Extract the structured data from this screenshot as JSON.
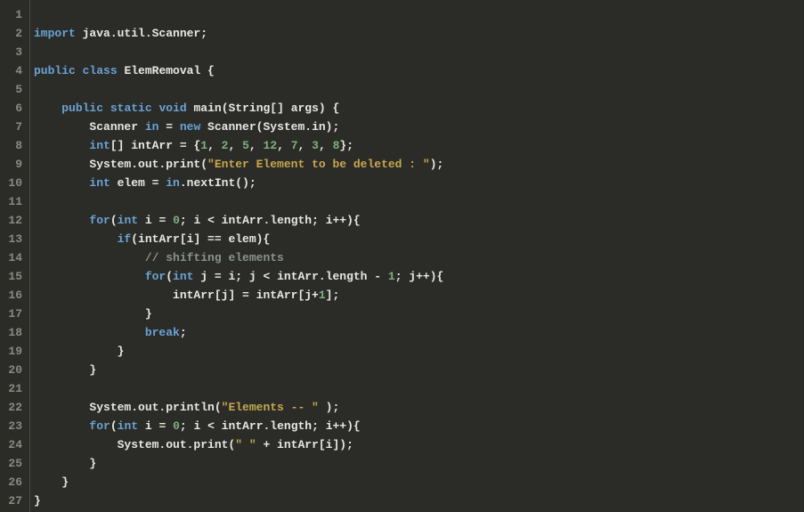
{
  "editor": {
    "lineNumbers": [
      1,
      2,
      3,
      4,
      5,
      6,
      7,
      8,
      9,
      10,
      11,
      12,
      13,
      14,
      15,
      16,
      17,
      18,
      19,
      20,
      21,
      22,
      23,
      24,
      25,
      26,
      27
    ],
    "lines": {
      "l1": "",
      "l2_import": "import",
      "l2_rest": " java.util.Scanner;",
      "l4_public": "public",
      "l4_class": "class",
      "l4_name": " ElemRemoval {",
      "l6_indent": "    ",
      "l6_public": "public",
      "l6_static": "static",
      "l6_void": "void",
      "l6_main": " main(String[] args) {",
      "l7_indent": "        Scanner ",
      "l7_in": "in",
      "l7_eq": " = ",
      "l7_new": "new",
      "l7_rest": " Scanner(System.in);",
      "l8_indent": "        ",
      "l8_int": "int",
      "l8_arr": "[] intArr = {",
      "l8_n1": "1",
      "l8_c": ", ",
      "l8_n2": "2",
      "l8_n3": "5",
      "l8_n4": "12",
      "l8_n5": "7",
      "l8_n6": "3",
      "l8_n7": "8",
      "l8_end": "};",
      "l9_indent": "        System.out.print(",
      "l9_str": "\"Enter Element to be deleted : \"",
      "l9_end": ");",
      "l10_indent": "        ",
      "l10_int": "int",
      "l10_elem": " elem = ",
      "l10_in": "in",
      "l10_rest": ".nextInt();",
      "l12_indent": "        ",
      "l12_for": "for",
      "l12_open": "(",
      "l12_int": "int",
      "l12_iinit": " i = ",
      "l12_zero": "0",
      "l12_rest": "; i < intArr.length; i++){",
      "l13_indent": "            ",
      "l13_if": "if",
      "l13_rest": "(intArr[i] == elem){",
      "l14_indent": "                ",
      "l14_comment": "// shifting elements",
      "l15_indent": "                ",
      "l15_for": "for",
      "l15_open": "(",
      "l15_int": "int",
      "l15_jinit": " j = i; j < intArr.length - ",
      "l15_one": "1",
      "l15_rest": "; j++){",
      "l16_indent": "                    intArr[j] = intArr[j+",
      "l16_one": "1",
      "l16_end": "];",
      "l17": "                }",
      "l18_indent": "                ",
      "l18_break": "break",
      "l18_semi": ";",
      "l19": "            }",
      "l20": "        }",
      "l22_indent": "        System.out.println(",
      "l22_str": "\"Elements -- \"",
      "l22_end": " );",
      "l23_indent": "        ",
      "l23_for": "for",
      "l23_open": "(",
      "l23_int": "int",
      "l23_iinit": " i = ",
      "l23_zero": "0",
      "l23_rest": "; i < intArr.length; i++){",
      "l24_indent": "            System.out.print(",
      "l24_str": "\" \"",
      "l24_rest": " + intArr[i]);",
      "l25": "        }",
      "l26": "    }",
      "l27": "}"
    }
  }
}
